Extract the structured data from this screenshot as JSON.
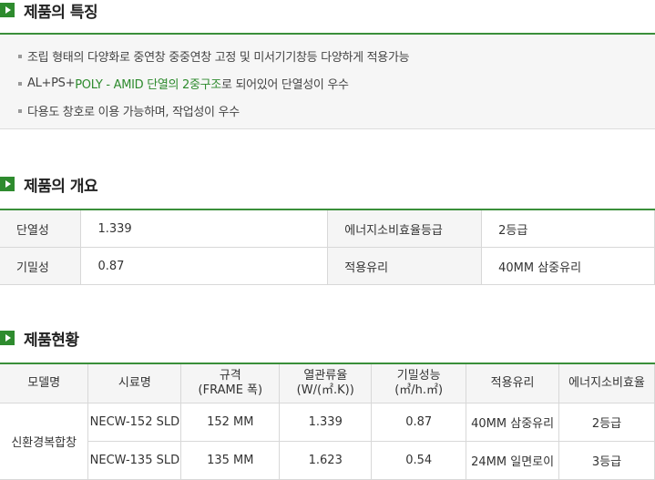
{
  "sections": {
    "features_title": "제품의 특징",
    "overview_title": "제품의 개요",
    "status_title": "제품현황"
  },
  "features": {
    "item1": "조립 형태의 다양화로 중연창 중중연창 고정 및 미서기기창등 다양하게 적용가능",
    "item2_pre": "AL+PS+",
    "item2_highlight": "POLY - AMID 단열의 2중구조",
    "item2_post": "로 되어있어 단열성이 우수",
    "item3": "다용도 창호로 이용 가능하며, 작업성이 우수"
  },
  "overview": {
    "rows": [
      {
        "label1": "단열성",
        "value1": "1.339",
        "label2": "에너지소비효율등급",
        "value2": "2등급"
      },
      {
        "label1": "기밀성",
        "value1": "0.87",
        "label2": "적용유리",
        "value2": "40MM 삼중유리"
      }
    ]
  },
  "status": {
    "headers": {
      "model": "모델명",
      "sample": "시료명",
      "spec_line1": "규격",
      "spec_line2": "(FRAME 폭)",
      "thermal_line1": "열관류율",
      "thermal_line2": "(W/(㎡.K))",
      "airtight_line1": "기밀성능",
      "airtight_line2": "(㎥/h.㎡)",
      "glass": "적용유리",
      "energy": "에너지소비효율"
    },
    "model_name": "신환경복합창",
    "rows": [
      {
        "sample": "NECW-152 SLD",
        "spec": "152 MM",
        "thermal": "1.339",
        "airtight": "0.87",
        "glass": "40MM 삼중유리",
        "energy": "2등급"
      },
      {
        "sample": "NECW-135 SLD",
        "spec": "135 MM",
        "thermal": "1.623",
        "airtight": "0.54",
        "glass": "24MM 일면로이",
        "energy": "3등급"
      }
    ]
  },
  "colors": {
    "accent": "#2e8b2e"
  }
}
